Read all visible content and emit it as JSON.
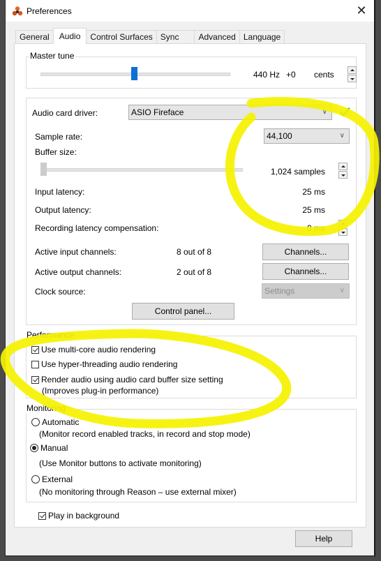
{
  "window": {
    "title": "Preferences",
    "app_icon": "reason-logo-icon",
    "close_icon": "close-icon"
  },
  "tabs": [
    {
      "label": "General",
      "active": false
    },
    {
      "label": "Audio",
      "active": true
    },
    {
      "label": "Control Surfaces",
      "active": false
    },
    {
      "label": "Sync",
      "active": false
    },
    {
      "label": "Advanced",
      "active": false
    },
    {
      "label": "Language",
      "active": false
    }
  ],
  "master_tune": {
    "legend": "Master tune",
    "slider_position_fraction": 0.5,
    "hz": "440 Hz",
    "offset": "+0",
    "unit": "cents"
  },
  "audio": {
    "driver_label": "Audio card driver:",
    "driver_value": "ASIO Fireface",
    "driver_status_icon": "checkmark-icon",
    "driver_status_color": "#2e9e2e",
    "sample_rate_label": "Sample rate:",
    "sample_rate_value": "44,100",
    "buffer_size_label": "Buffer size:",
    "buffer_slider_fraction": 0.0,
    "buffer_size_value": "1,024 samples",
    "input_latency_label": "Input latency:",
    "input_latency_value": "25 ms",
    "output_latency_label": "Output latency:",
    "output_latency_value": "25 ms",
    "rec_comp_label": "Recording latency compensation:",
    "rec_comp_value": "0 ms",
    "active_input_label": "Active input channels:",
    "active_input_value": "8 out of 8",
    "active_input_button": "Channels...",
    "active_output_label": "Active output channels:",
    "active_output_value": "2 out of 8",
    "active_output_button": "Channels...",
    "clock_source_label": "Clock source:",
    "clock_source_value": "Settings",
    "control_panel_button": "Control panel..."
  },
  "performance": {
    "legend": "Performance",
    "options": [
      {
        "label": "Use multi-core audio rendering",
        "checked": true
      },
      {
        "label": "Use hyper-threading audio rendering",
        "checked": false
      },
      {
        "label": "Render audio using audio card buffer size setting",
        "checked": true,
        "note": "(Improves plug-in performance)"
      }
    ]
  },
  "monitoring": {
    "legend": "Monitoring",
    "options": [
      {
        "label": "Automatic",
        "note": "(Monitor record enabled tracks, in record and stop mode)",
        "selected": false
      },
      {
        "label": "Manual",
        "note": "(Use Monitor buttons to activate monitoring)",
        "selected": true
      },
      {
        "label": "External",
        "note": "(No monitoring through Reason – use external mixer)",
        "selected": false
      }
    ]
  },
  "play_in_background": {
    "label": "Play in background",
    "checked": true
  },
  "footer": {
    "help_button": "Help"
  },
  "annotation": {
    "highlight_color": "#f5f200"
  }
}
